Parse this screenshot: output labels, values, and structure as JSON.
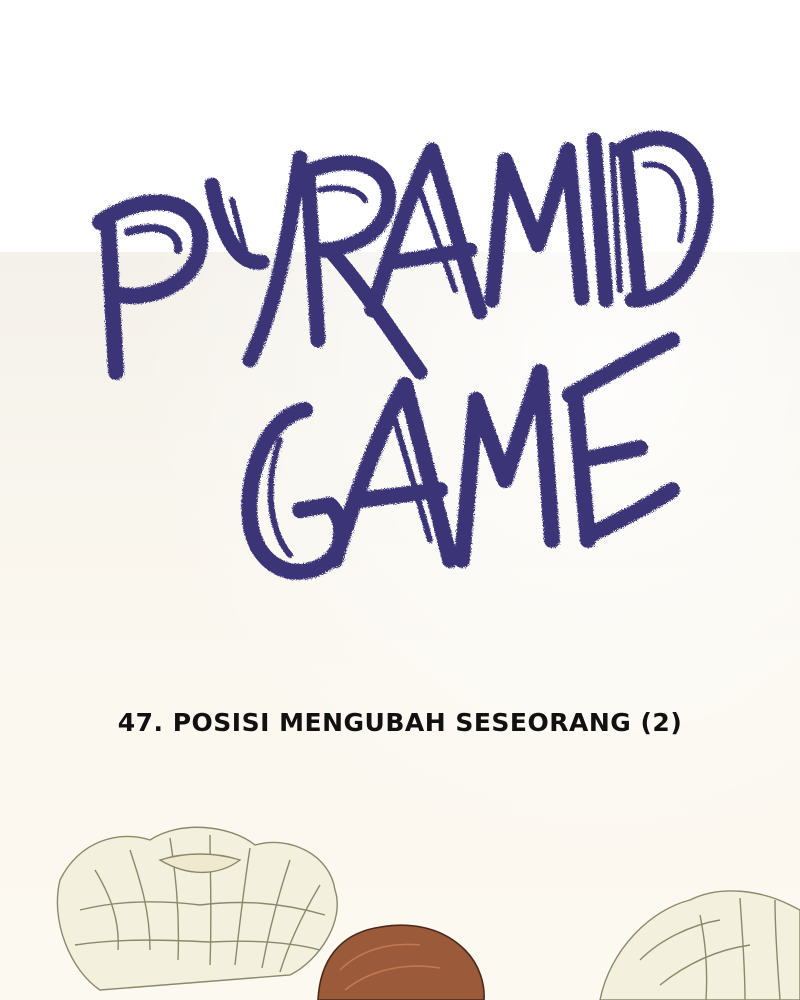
{
  "comic": {
    "logo_text": "PYRAMID GAME",
    "chapter_title": "47. POSISI MENGUBAH SESEORANG (2)"
  },
  "colors": {
    "logo_ink": "#3a3477",
    "title_ink": "#111111",
    "background_top": "#ffffff",
    "background_panel": "#f6f3ec",
    "flower_petal": "#f3efdc",
    "flower_outline": "#8a8a6a",
    "hair": "#9b5a3a"
  },
  "illustration": {
    "elements": [
      "chrysanthemum-left",
      "chrysanthemum-right",
      "character-head"
    ]
  }
}
